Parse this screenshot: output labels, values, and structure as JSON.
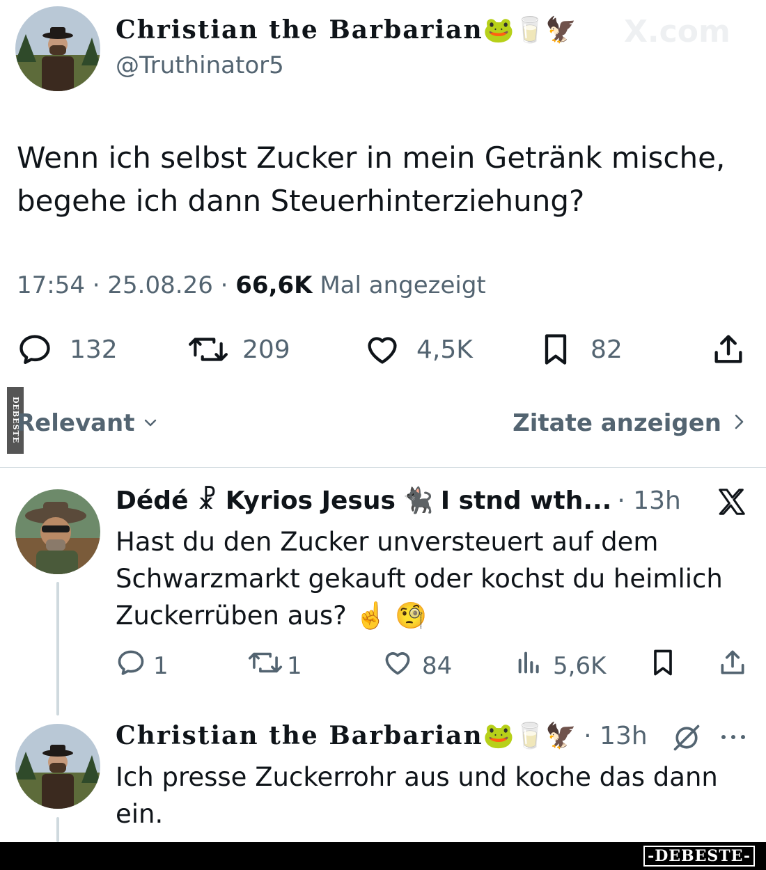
{
  "main_tweet": {
    "author_name": "Christian the Barbarian",
    "author_emojis": "🐸🥛🦅",
    "author_handle": "@Truthinator5",
    "watermark": "X.com",
    "text_line1": "Wenn ich selbst Zucker in mein Getränk mische,",
    "text_line2": "begehe ich dann Steuerhinterziehung?",
    "time": "17:54",
    "date": "25.08.26",
    "views_count": "66,6K",
    "views_label": "Mal angezeigt",
    "stats": {
      "replies": "132",
      "reposts": "209",
      "likes": "4,5K",
      "bookmarks": "82"
    }
  },
  "sort_bar": {
    "sort_label": "Relevant",
    "quotes_label": "Zitate anzeigen"
  },
  "reply1": {
    "name_part1": "Dédé ☧ Kyrios Jesus",
    "name_emoji": "🐈‍⬛",
    "name_part2": "I stnd wth...",
    "time": "· 13h",
    "text": "Hast du den Zucker unversteuert auf dem Schwarzmarkt gekauft oder kochst du heimlich Zuckerrüben aus? ☝️ 🧐",
    "stats": {
      "replies": "1",
      "reposts": "1",
      "likes": "84",
      "views": "5,6K"
    }
  },
  "reply2": {
    "name": "Christian the Barbarian",
    "name_emojis": "🐸🥛🦅",
    "time": "· 13h",
    "text": "Ich presse Zuckerrohr aus und koche das dann ein."
  },
  "branding": {
    "side_stamp": "DEBESTE",
    "footer_logo": "-DEBESTE-"
  },
  "colors": {
    "text_primary": "#0f1419",
    "text_secondary": "#536471",
    "divider": "#cfd9de",
    "footer_bg": "#000000"
  },
  "icons": [
    "reply-icon",
    "repost-icon",
    "like-icon",
    "bookmark-icon",
    "share-icon",
    "views-icon",
    "x-logo-icon",
    "chevron-down-icon",
    "chevron-right-icon",
    "grok-icon",
    "more-icon"
  ]
}
